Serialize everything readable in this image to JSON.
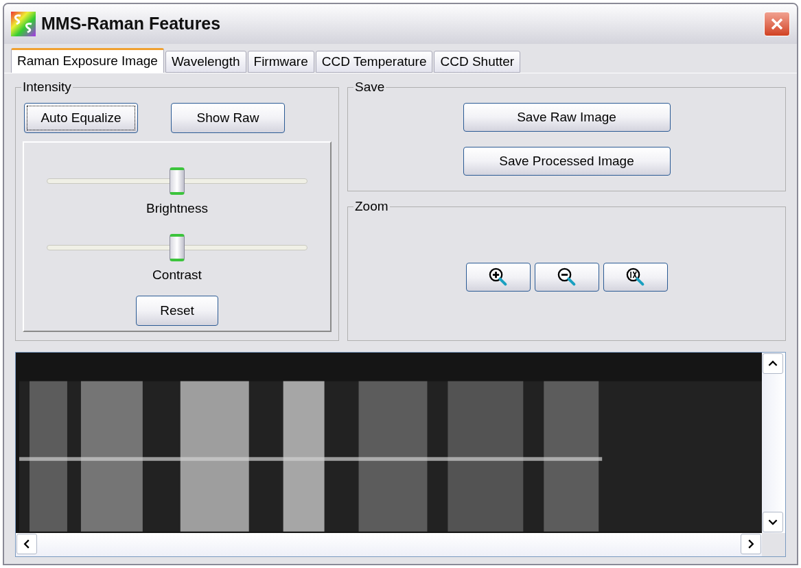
{
  "window": {
    "title": "MMS-Raman Features"
  },
  "tabs": [
    {
      "label": "Raman Exposure Image",
      "selected": true
    },
    {
      "label": "Wavelength",
      "selected": false
    },
    {
      "label": "Firmware",
      "selected": false
    },
    {
      "label": "CCD Temperature",
      "selected": false
    },
    {
      "label": "CCD Shutter",
      "selected": false
    }
  ],
  "intensity": {
    "title": "Intensity",
    "buttons": [
      {
        "label": "Auto Equalize",
        "focused": true
      },
      {
        "label": "Show Raw",
        "focused": false
      }
    ],
    "sliders": [
      {
        "label": "Brightness",
        "level": 0.5
      },
      {
        "label": "Contrast",
        "level": 0.5
      }
    ],
    "reset": "Reset"
  },
  "save": {
    "title": "Save",
    "buttons": [
      "Save Raw Image",
      "Save Processed Image"
    ]
  },
  "zoom": {
    "title": "Zoom",
    "buttons": [
      {
        "kind": "zoom_in"
      },
      {
        "kind": "zoom_out"
      },
      {
        "kind": "zoom_reset"
      }
    ]
  }
}
